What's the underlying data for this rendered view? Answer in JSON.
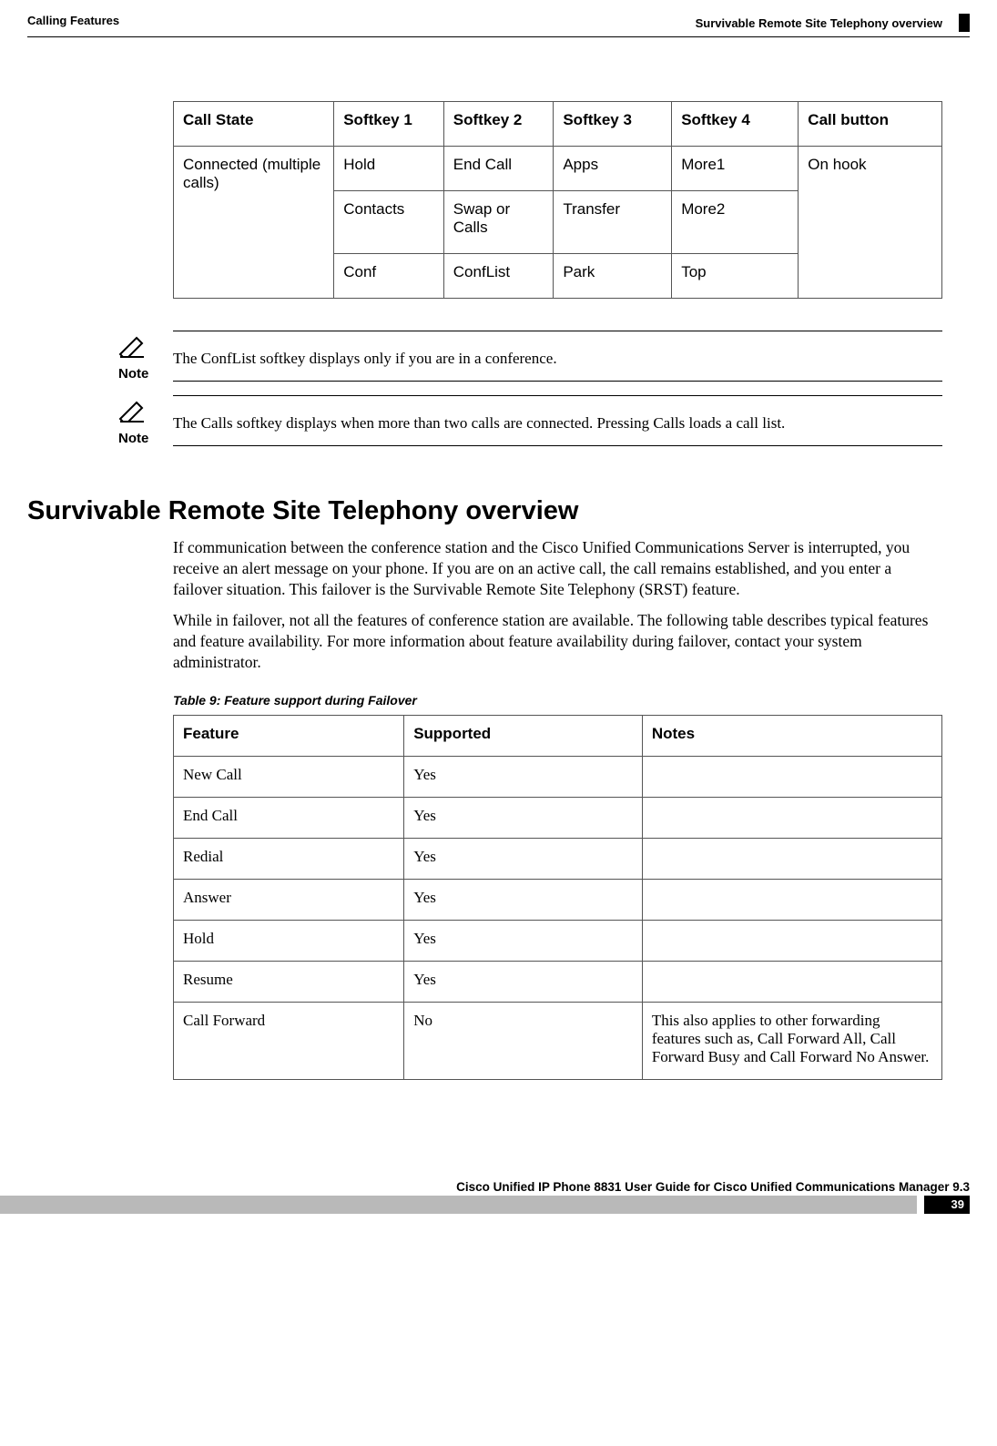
{
  "header": {
    "left": "Calling Features",
    "right": "Survivable Remote Site Telephony overview"
  },
  "softkey_table": {
    "headers": [
      "Call State",
      "Softkey 1",
      "Softkey 2",
      "Softkey 3",
      "Softkey 4",
      "Call button"
    ],
    "state": "Connected (multiple calls)",
    "call_button": "On hook",
    "rows": [
      [
        "Hold",
        "End Call",
        "Apps",
        "More1"
      ],
      [
        "Contacts",
        "Swap or Calls",
        "Transfer",
        "More2"
      ],
      [
        "Conf",
        "ConfList",
        "Park",
        "Top"
      ]
    ]
  },
  "notes": {
    "label": "Note",
    "items": [
      "The ConfList softkey displays only if you are in a conference.",
      "The Calls softkey displays when more than two calls are connected. Pressing Calls loads a call list."
    ]
  },
  "section": {
    "title": "Survivable Remote Site Telephony overview",
    "paragraphs": [
      "If communication between the conference station and the Cisco Unified Communications Server is interrupted, you receive an alert message on your phone. If you are on an active call, the call remains established, and you enter a failover situation. This failover is the Survivable Remote Site Telephony (SRST) feature.",
      "While in failover, not all the features of conference station are available. The following table describes typical features and feature availability. For more information about feature availability during failover, contact your system administrator."
    ]
  },
  "feature_table": {
    "caption": "Table 9: Feature support during Failover",
    "headers": [
      "Feature",
      "Supported",
      "Notes"
    ],
    "rows": [
      {
        "feature": "New Call",
        "supported": "Yes",
        "notes": ""
      },
      {
        "feature": "End Call",
        "supported": "Yes",
        "notes": ""
      },
      {
        "feature": "Redial",
        "supported": "Yes",
        "notes": ""
      },
      {
        "feature": "Answer",
        "supported": "Yes",
        "notes": ""
      },
      {
        "feature": "Hold",
        "supported": "Yes",
        "notes": ""
      },
      {
        "feature": "Resume",
        "supported": "Yes",
        "notes": ""
      },
      {
        "feature": "Call Forward",
        "supported": "No",
        "notes": "This also applies to other forwarding features such as, Call Forward All, Call Forward Busy and Call Forward No Answer."
      }
    ]
  },
  "footer": {
    "title": "Cisco Unified IP Phone 8831 User Guide for Cisco Unified Communications Manager 9.3",
    "page": "39"
  }
}
